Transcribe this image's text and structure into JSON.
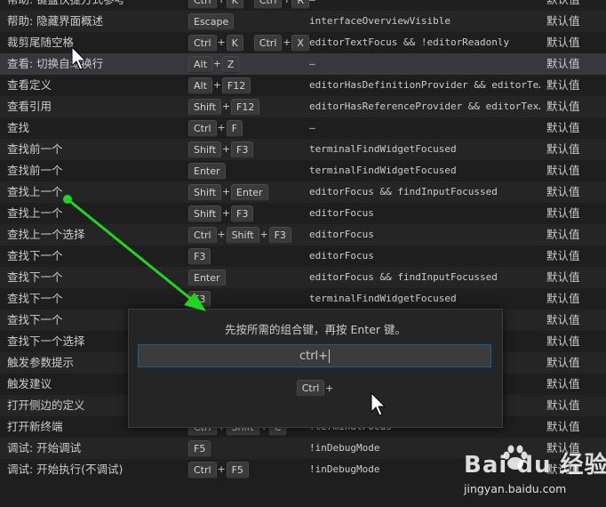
{
  "rows": [
    {
      "cmd": "帮助: 键盘快捷方式参考",
      "keys": [
        [
          "Ctrl",
          "K"
        ],
        [
          "Ctrl",
          "R"
        ]
      ],
      "when": "—",
      "src": "默认值"
    },
    {
      "cmd": "帮助: 隐藏界面概述",
      "keys": [
        [
          "Escape"
        ]
      ],
      "when": "interfaceOverviewVisible",
      "src": "默认值"
    },
    {
      "cmd": "裁剪尾随空格",
      "keys": [
        [
          "Ctrl",
          "K"
        ],
        [
          "Ctrl",
          "X"
        ]
      ],
      "when": "editorTextFocus && !editorReadonly",
      "src": "默认值"
    },
    {
      "cmd": "查看: 切换自动换行",
      "keys": [
        [
          "Alt",
          "Z"
        ]
      ],
      "when": "—",
      "src": "默认值"
    },
    {
      "cmd": "查看定义",
      "keys": [
        [
          "Alt",
          "F12"
        ]
      ],
      "when": "editorHasDefinitionProvider && editorTe…",
      "src": "默认值"
    },
    {
      "cmd": "查看引用",
      "keys": [
        [
          "Shift",
          "F12"
        ]
      ],
      "when": "editorHasReferenceProvider && editorTex…",
      "src": "默认值"
    },
    {
      "cmd": "查找",
      "keys": [
        [
          "Ctrl",
          "F"
        ]
      ],
      "when": "—",
      "src": "默认值"
    },
    {
      "cmd": "查找前一个",
      "keys": [
        [
          "Shift",
          "F3"
        ]
      ],
      "when": "terminalFindWidgetFocused",
      "src": "默认值"
    },
    {
      "cmd": "查找前一个",
      "keys": [
        [
          "Enter"
        ]
      ],
      "when": "terminalFindWidgetFocused",
      "src": "默认值"
    },
    {
      "cmd": "查找上一个",
      "keys": [
        [
          "Shift",
          "Enter"
        ]
      ],
      "when": "editorFocus && findInputFocussed",
      "src": "默认值"
    },
    {
      "cmd": "查找上一个",
      "keys": [
        [
          "Shift",
          "F3"
        ]
      ],
      "when": "editorFocus",
      "src": "默认值"
    },
    {
      "cmd": "查找上一个选择",
      "keys": [
        [
          "Ctrl",
          "Shift",
          "F3"
        ]
      ],
      "when": "editorFocus",
      "src": "默认值"
    },
    {
      "cmd": "查找下一个",
      "keys": [
        [
          "F3"
        ]
      ],
      "when": "editorFocus",
      "src": "默认值"
    },
    {
      "cmd": "查找下一个",
      "keys": [
        [
          "Enter"
        ]
      ],
      "when": "editorFocus && findInputFocussed",
      "src": "默认值"
    },
    {
      "cmd": "查找下一个",
      "keys": [
        [
          "F3"
        ]
      ],
      "when": "terminalFindWidgetFocused",
      "src": "默认值"
    },
    {
      "cmd": "查找下一个",
      "keys": [],
      "when": "",
      "src": "默认值"
    },
    {
      "cmd": "查找下一个选择",
      "keys": [],
      "when": "",
      "src": "默认值"
    },
    {
      "cmd": "触发参数提示",
      "keys": [],
      "when": "edito…",
      "src": "默认值"
    },
    {
      "cmd": "触发建议",
      "keys": [],
      "when": "& text…",
      "src": "默认值"
    },
    {
      "cmd": "打开侧边的定义",
      "keys": [],
      "when": "itorTe…",
      "src": "默认值"
    },
    {
      "cmd": "打开新终端",
      "keys": [
        [
          "Ctrl",
          "Shift",
          "C"
        ]
      ],
      "when": "!terminalFocus",
      "src": "默认值"
    },
    {
      "cmd": "调试: 开始调试",
      "keys": [
        [
          "F5"
        ]
      ],
      "when": "!inDebugMode",
      "src": "默认值"
    },
    {
      "cmd": "调试: 开始执行(不调试)",
      "keys": [
        [
          "Ctrl",
          "F5"
        ]
      ],
      "when": "!inDebugMode",
      "src": "默认值"
    }
  ],
  "dialog": {
    "message": "先按所需的组合键，再按 Enter 键。",
    "input_value": "ctrl+",
    "preview_key": "Ctrl",
    "preview_plus": "+"
  },
  "watermark": {
    "brand": "Bai du 经验",
    "url": "jingyan.baidu.com"
  },
  "colors": {
    "arrow": "#22d61f",
    "selection": "#37373d",
    "focus_border": "#0e639c"
  }
}
